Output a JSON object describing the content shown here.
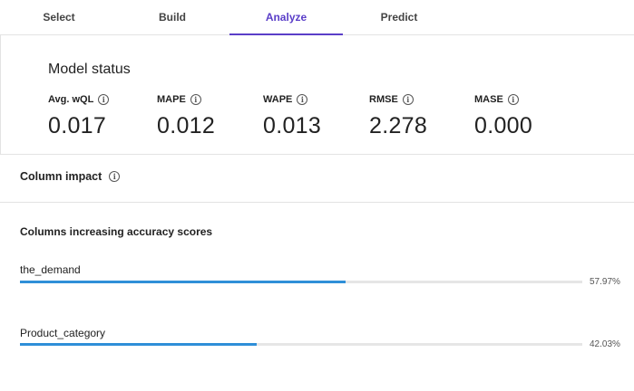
{
  "tabs": [
    {
      "label": "Select",
      "active": false
    },
    {
      "label": "Build",
      "active": false
    },
    {
      "label": "Analyze",
      "active": true
    },
    {
      "label": "Predict",
      "active": false
    }
  ],
  "model_status": {
    "title": "Model status",
    "metrics": [
      {
        "label": "Avg. wQL",
        "value": "0.017"
      },
      {
        "label": "MAPE",
        "value": "0.012"
      },
      {
        "label": "WAPE",
        "value": "0.013"
      },
      {
        "label": "RMSE",
        "value": "2.278"
      },
      {
        "label": "MASE",
        "value": "0.000"
      }
    ]
  },
  "column_impact": {
    "title": "Column impact"
  },
  "accuracy": {
    "title": "Columns increasing accuracy scores",
    "columns": [
      {
        "name": "the_demand",
        "percent_label": "57.97%",
        "fraction": 0.5797
      },
      {
        "name": "Product_category",
        "percent_label": "42.03%",
        "fraction": 0.4203
      }
    ]
  },
  "colors": {
    "accent": "#5a3ec8",
    "bar_fill": "#2f8fd8",
    "bar_track": "#e6e6e6"
  }
}
